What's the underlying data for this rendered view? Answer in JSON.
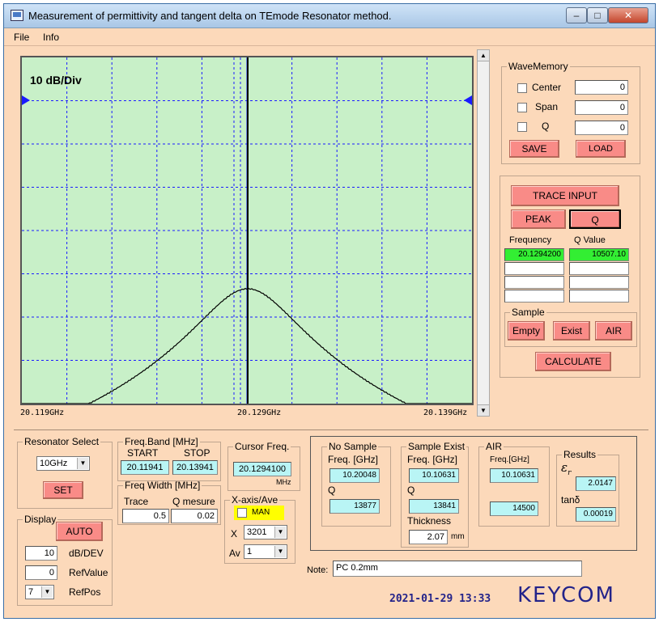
{
  "window": {
    "title": "Measurement of permittivity and tangent delta on TEmode Resonator method.",
    "min_glyph": "–",
    "max_glyph": "□",
    "close_glyph": "✕"
  },
  "menu": {
    "file": "File",
    "info": "Info"
  },
  "plot": {
    "scale_label": "10 dB/Div",
    "x_labels": [
      "20.119GHz",
      "20.129GHz",
      "20.139GHz"
    ]
  },
  "wave_memory": {
    "legend": "WaveMemory",
    "center_label": "Center",
    "center_value": "0",
    "span_label": "Span",
    "span_value": "0",
    "q_label": "Q",
    "q_value": "0",
    "save": "SAVE",
    "load": "LOAD"
  },
  "trace": {
    "trace_input": "TRACE INPUT",
    "peak": "PEAK",
    "q": "Q",
    "frequency_header": "Frequency",
    "qvalue_header": "Q Value",
    "frequency_1": "20.1294200",
    "qvalue_1": "10507.10"
  },
  "sample": {
    "legend": "Sample",
    "empty": "Empty",
    "exist": "Exist",
    "air": "AIR",
    "calculate": "CALCULATE"
  },
  "resonator": {
    "legend": "Resonator Select",
    "value": "10GHz",
    "set": "SET"
  },
  "freq_band": {
    "legend": "Freq.Band [MHz]",
    "start_label": "START",
    "stop_label": "STOP",
    "start_value": "20.11941",
    "stop_value": "20.13941"
  },
  "cursor": {
    "legend": "Cursor Freq.",
    "value": "20.1294100",
    "unit": "MHz"
  },
  "freq_width": {
    "legend": "Freq Width [MHz]",
    "trace_label": "Trace",
    "q_label": "Q mesure",
    "trace_value": "0.5",
    "q_value": "0.02"
  },
  "display": {
    "legend": "Display",
    "auto": "AUTO",
    "db_value": "10",
    "db_label": "dB/DEV",
    "ref_value": "0",
    "ref_label": "RefValue",
    "refpos_value": "7",
    "refpos_label": "RefPos"
  },
  "xaxis": {
    "legend": "X-axis/Ave",
    "man": "MAN",
    "x_label": "X",
    "x_value": "3201",
    "av_label": "Av",
    "av_value": "1"
  },
  "no_sample": {
    "legend": "No Sample",
    "freq_label": "Freq. [GHz]",
    "freq_value": "10.20048",
    "q_label": "Q",
    "q_value": "13877"
  },
  "sample_exist": {
    "legend": "Sample Exist",
    "freq_label": "Freq. [GHz]",
    "freq_value": "10.10631",
    "q_label": "Q",
    "q_value": "13841",
    "thickness_label": "Thickness",
    "thickness_value": "2.07",
    "thickness_unit": "mm"
  },
  "air": {
    "legend": "AIR",
    "freq_label": "Freq.[GHz]",
    "freq_value": "10.10631",
    "q_value": "14500"
  },
  "results": {
    "legend": "Results",
    "er_label": "ε",
    "er_sub": "r",
    "er_value": "2.0147",
    "tand_label": "tanδ",
    "tand_value": "0.00019"
  },
  "note": {
    "label": "Note:",
    "value": "PC 0.2mm"
  },
  "footer": {
    "datetime": "2021-01-29 13:33",
    "logo": "KEYCOM"
  }
}
